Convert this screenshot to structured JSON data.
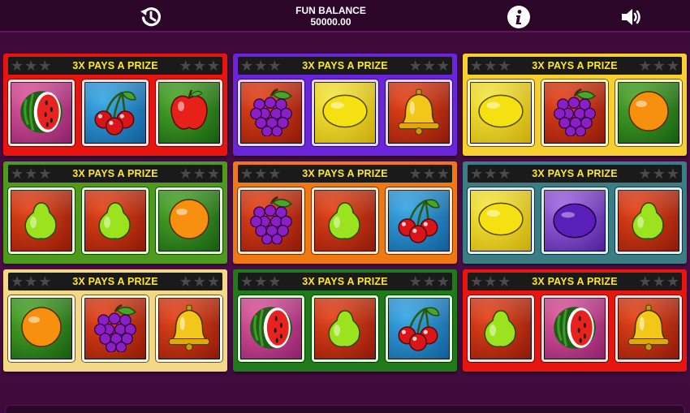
{
  "topbar": {
    "history_icon": "history-icon",
    "balance_label": "FUN BALANCE",
    "balance_value": "50000.00",
    "info_icon": "info-icon",
    "sound_icon": "speaker-icon"
  },
  "prize_text": "3X PAYS A PRIZE",
  "colors": {
    "red": "#e8140e",
    "purple": "#6a24d9",
    "yellow": "#f7d030",
    "green": "#4e9a1c",
    "orange": "#f07810",
    "teal": "#3a7d84",
    "cream": "#f3d887",
    "darkgreen": "#1f7a1a"
  },
  "cards": [
    {
      "frame": "red",
      "symbols": [
        "watermelon",
        "cherries",
        "apple"
      ]
    },
    {
      "frame": "purple",
      "symbols": [
        "grapes",
        "lemon",
        "bell"
      ]
    },
    {
      "frame": "yellow",
      "symbols": [
        "lemon",
        "grapes",
        "orange"
      ]
    },
    {
      "frame": "green",
      "symbols": [
        "pear",
        "pear",
        "orange"
      ]
    },
    {
      "frame": "orange",
      "symbols": [
        "grapes",
        "pear",
        "cherries"
      ]
    },
    {
      "frame": "teal",
      "symbols": [
        "lemon",
        "plum",
        "pear"
      ]
    },
    {
      "frame": "cream",
      "symbols": [
        "orange",
        "grapes",
        "bell"
      ]
    },
    {
      "frame": "darkgreen",
      "symbols": [
        "watermelon",
        "pear",
        "cherries"
      ]
    },
    {
      "frame": "red",
      "symbols": [
        "pear",
        "watermelon",
        "bell"
      ]
    }
  ]
}
